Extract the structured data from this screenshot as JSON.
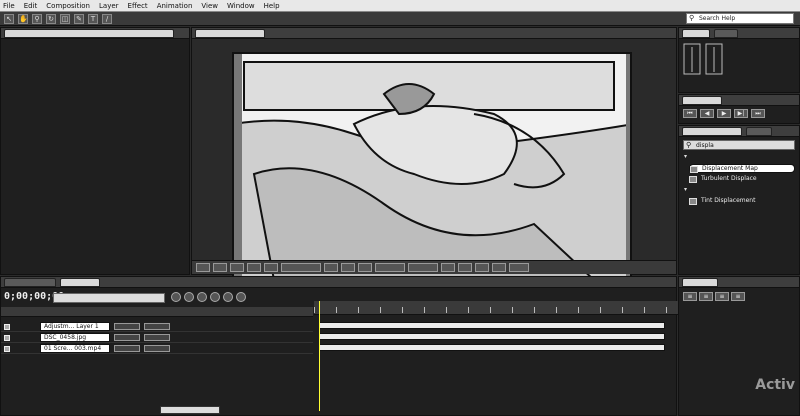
{
  "menu": [
    "File",
    "Edit",
    "Composition",
    "Layer",
    "Effect",
    "Animation",
    "View",
    "Window",
    "Help"
  ],
  "search_help": {
    "label": "Search Help"
  },
  "effects": {
    "search_value": "displa",
    "items": [
      {
        "label": "Displacement Map",
        "selected": true
      },
      {
        "label": "Turbulent Displace",
        "selected": false
      }
    ],
    "folder_item": "Tint Displacement"
  },
  "timeline": {
    "layers": [
      {
        "name": "Adjustm... Layer 1"
      },
      {
        "name": "DSC_0458.jpg"
      },
      {
        "name": "01 Scre... 003.mp4"
      }
    ]
  },
  "watermark": {
    "line1": "Activ"
  }
}
